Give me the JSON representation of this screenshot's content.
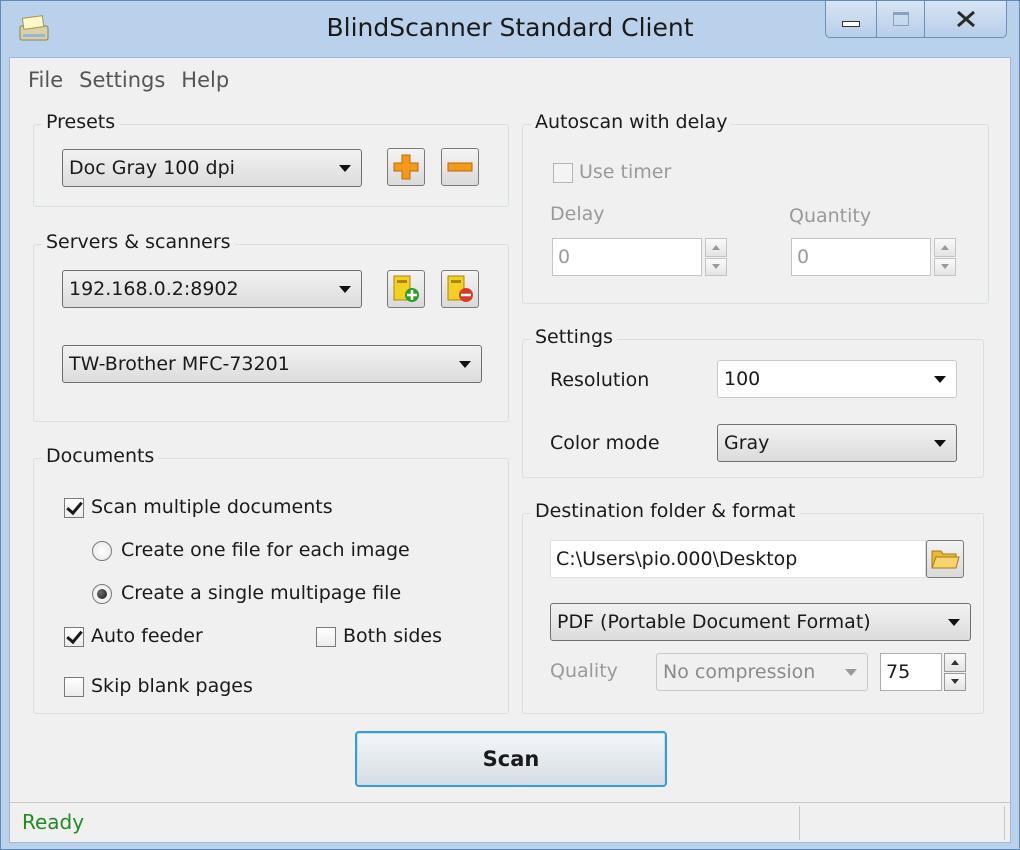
{
  "window": {
    "title": "BlindScanner Standard Client"
  },
  "menu": [
    "File",
    "Settings",
    "Help"
  ],
  "presets": {
    "group_label": "Presets",
    "selected": "Doc Gray 100 dpi"
  },
  "servers": {
    "group_label": "Servers & scanners",
    "server_selected": "192.168.0.2:8902",
    "scanner_selected": "TW-Brother MFC-73201"
  },
  "documents": {
    "group_label": "Documents",
    "scan_multiple": {
      "label": "Scan multiple documents",
      "checked": true
    },
    "one_file_each": {
      "label": "Create one file for each image",
      "selected": false
    },
    "single_multipage": {
      "label": "Create a single multipage file",
      "selected": true
    },
    "auto_feeder": {
      "label": "Auto feeder",
      "checked": true
    },
    "both_sides": {
      "label": "Both sides",
      "checked": false
    },
    "skip_blank": {
      "label": "Skip blank pages",
      "checked": false
    }
  },
  "autoscan": {
    "group_label": "Autoscan with delay",
    "use_timer": {
      "label": "Use timer",
      "checked": false
    },
    "delay_label": "Delay",
    "delay_value": "0",
    "quantity_label": "Quantity",
    "quantity_value": "0"
  },
  "settings": {
    "group_label": "Settings",
    "resolution_label": "Resolution",
    "resolution_value": "100",
    "color_mode_label": "Color mode",
    "color_mode_value": "Gray"
  },
  "destination": {
    "group_label": "Destination folder & format",
    "folder_path": "C:\\Users\\pio.000\\Desktop",
    "format_value": "PDF (Portable Document Format)",
    "quality_label": "Quality",
    "compression_value": "No compression",
    "quality_value": "75"
  },
  "scan_button": "Scan",
  "status": {
    "text": "Ready",
    "color": "#228b22"
  }
}
